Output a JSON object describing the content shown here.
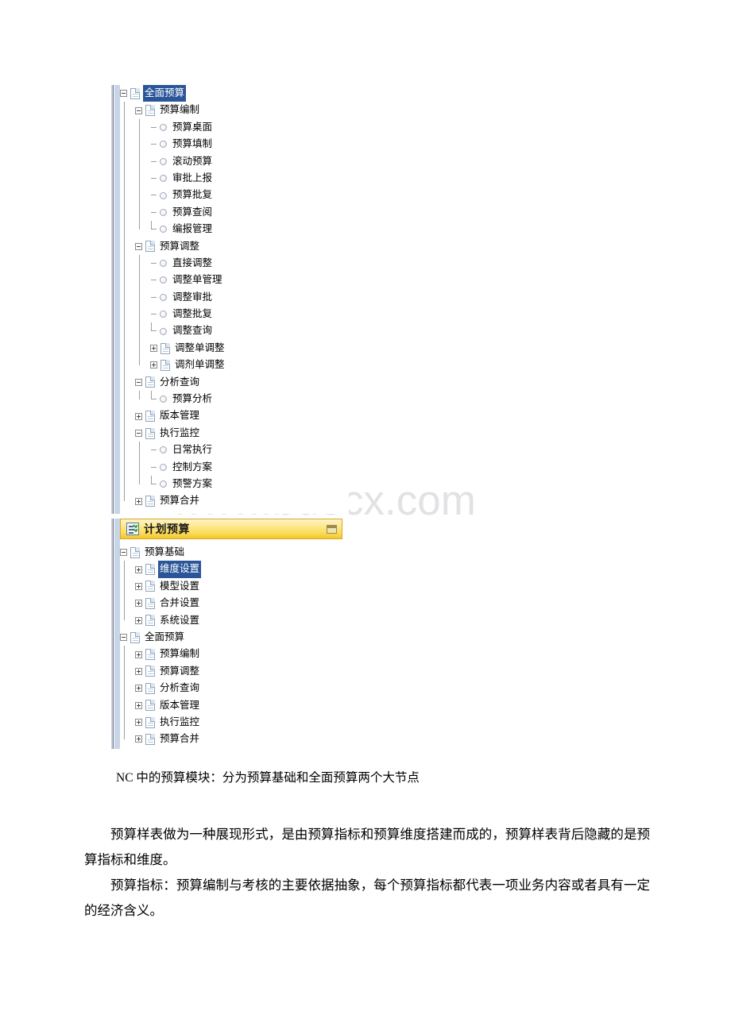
{
  "watermark": "www.bdocx.com",
  "panel_one": {
    "name": "budget-tree-expanded",
    "nodes": [
      {
        "label": "全面预算",
        "depth": 0,
        "type": "folder",
        "state": "minus",
        "selected": true
      },
      {
        "label": "预算编制",
        "depth": 1,
        "type": "folder",
        "state": "minus",
        "selected": false
      },
      {
        "label": "预算桌面",
        "depth": 2,
        "type": "leaf",
        "state": "none",
        "selected": false
      },
      {
        "label": "预算填制",
        "depth": 2,
        "type": "leaf",
        "state": "none",
        "selected": false
      },
      {
        "label": "滚动预算",
        "depth": 2,
        "type": "leaf",
        "state": "none",
        "selected": false
      },
      {
        "label": "审批上报",
        "depth": 2,
        "type": "leaf",
        "state": "none",
        "selected": false
      },
      {
        "label": "预算批复",
        "depth": 2,
        "type": "leaf",
        "state": "none",
        "selected": false
      },
      {
        "label": "预算查阅",
        "depth": 2,
        "type": "leaf",
        "state": "none",
        "selected": false
      },
      {
        "label": "编报管理",
        "depth": 2,
        "type": "leaf",
        "state": "none",
        "selected": false,
        "last": true
      },
      {
        "label": "预算调整",
        "depth": 1,
        "type": "folder",
        "state": "minus",
        "selected": false
      },
      {
        "label": "直接调整",
        "depth": 2,
        "type": "leaf",
        "state": "none",
        "selected": false
      },
      {
        "label": "调整单管理",
        "depth": 2,
        "type": "leaf",
        "state": "none",
        "selected": false
      },
      {
        "label": "调整审批",
        "depth": 2,
        "type": "leaf",
        "state": "none",
        "selected": false
      },
      {
        "label": "调整批复",
        "depth": 2,
        "type": "leaf",
        "state": "none",
        "selected": false
      },
      {
        "label": "调整查询",
        "depth": 2,
        "type": "leaf",
        "state": "none",
        "selected": false,
        "last": true
      },
      {
        "label": "调整单调整",
        "depth": 2,
        "type": "folder",
        "state": "plus",
        "selected": false
      },
      {
        "label": "调剂单调整",
        "depth": 2,
        "type": "folder",
        "state": "plus",
        "selected": false
      },
      {
        "label": "分析查询",
        "depth": 1,
        "type": "folder",
        "state": "minus",
        "selected": false
      },
      {
        "label": "预算分析",
        "depth": 2,
        "type": "leaf",
        "state": "none",
        "selected": false,
        "last": true
      },
      {
        "label": "版本管理",
        "depth": 1,
        "type": "folder",
        "state": "plus",
        "selected": false
      },
      {
        "label": "执行监控",
        "depth": 1,
        "type": "folder",
        "state": "minus",
        "selected": false
      },
      {
        "label": "日常执行",
        "depth": 2,
        "type": "leaf",
        "state": "none",
        "selected": false
      },
      {
        "label": "控制方案",
        "depth": 2,
        "type": "leaf",
        "state": "none",
        "selected": false
      },
      {
        "label": "预警方案",
        "depth": 2,
        "type": "leaf",
        "state": "none",
        "selected": false,
        "last": true
      },
      {
        "label": "预算合并",
        "depth": 1,
        "type": "folder",
        "state": "plus",
        "selected": false
      }
    ]
  },
  "panel_two": {
    "name": "plan-budget-tree",
    "titlebar": {
      "title": "计划预算",
      "icon": "checklist-document-icon",
      "restore_button": "restore-icon"
    },
    "nodes": [
      {
        "label": "预算基础",
        "depth": 0,
        "type": "folder",
        "state": "minus",
        "selected": false
      },
      {
        "label": "维度设置",
        "depth": 1,
        "type": "folder",
        "state": "plus",
        "selected": true
      },
      {
        "label": "模型设置",
        "depth": 1,
        "type": "folder",
        "state": "plus",
        "selected": false
      },
      {
        "label": "合并设置",
        "depth": 1,
        "type": "folder",
        "state": "plus",
        "selected": false
      },
      {
        "label": "系统设置",
        "depth": 1,
        "type": "folder",
        "state": "plus",
        "selected": false
      },
      {
        "label": "全面预算",
        "depth": 0,
        "type": "folder",
        "state": "minus",
        "selected": false
      },
      {
        "label": "预算编制",
        "depth": 1,
        "type": "folder",
        "state": "plus",
        "selected": false
      },
      {
        "label": "预算调整",
        "depth": 1,
        "type": "folder",
        "state": "plus",
        "selected": false
      },
      {
        "label": "分析查询",
        "depth": 1,
        "type": "folder",
        "state": "plus",
        "selected": false
      },
      {
        "label": "版本管理",
        "depth": 1,
        "type": "folder",
        "state": "plus",
        "selected": false
      },
      {
        "label": "执行监控",
        "depth": 1,
        "type": "folder",
        "state": "plus",
        "selected": false
      },
      {
        "label": "预算合并",
        "depth": 1,
        "type": "folder",
        "state": "plus",
        "selected": false
      }
    ]
  },
  "document": {
    "para_one": "NC 中的预算模块：分为预算基础和全面预算两个大节点",
    "para_two": "预算样表做为一种展现形式，是由预算指标和预算维度搭建而成的，预算样表背后隐藏的是预算指标和维度。",
    "para_three": "预算指标：预算编制与考核的主要依据抽象，每个预算指标都代表一项业务内容或者具有一定的经济含义。"
  },
  "colors": {
    "selection": "#2a5699",
    "titlebar_accent": "#fbdc5c",
    "titlebar_border": "#d9a62b",
    "watermark": "#e2e2e4",
    "tree_line": "#9aa0a8"
  }
}
